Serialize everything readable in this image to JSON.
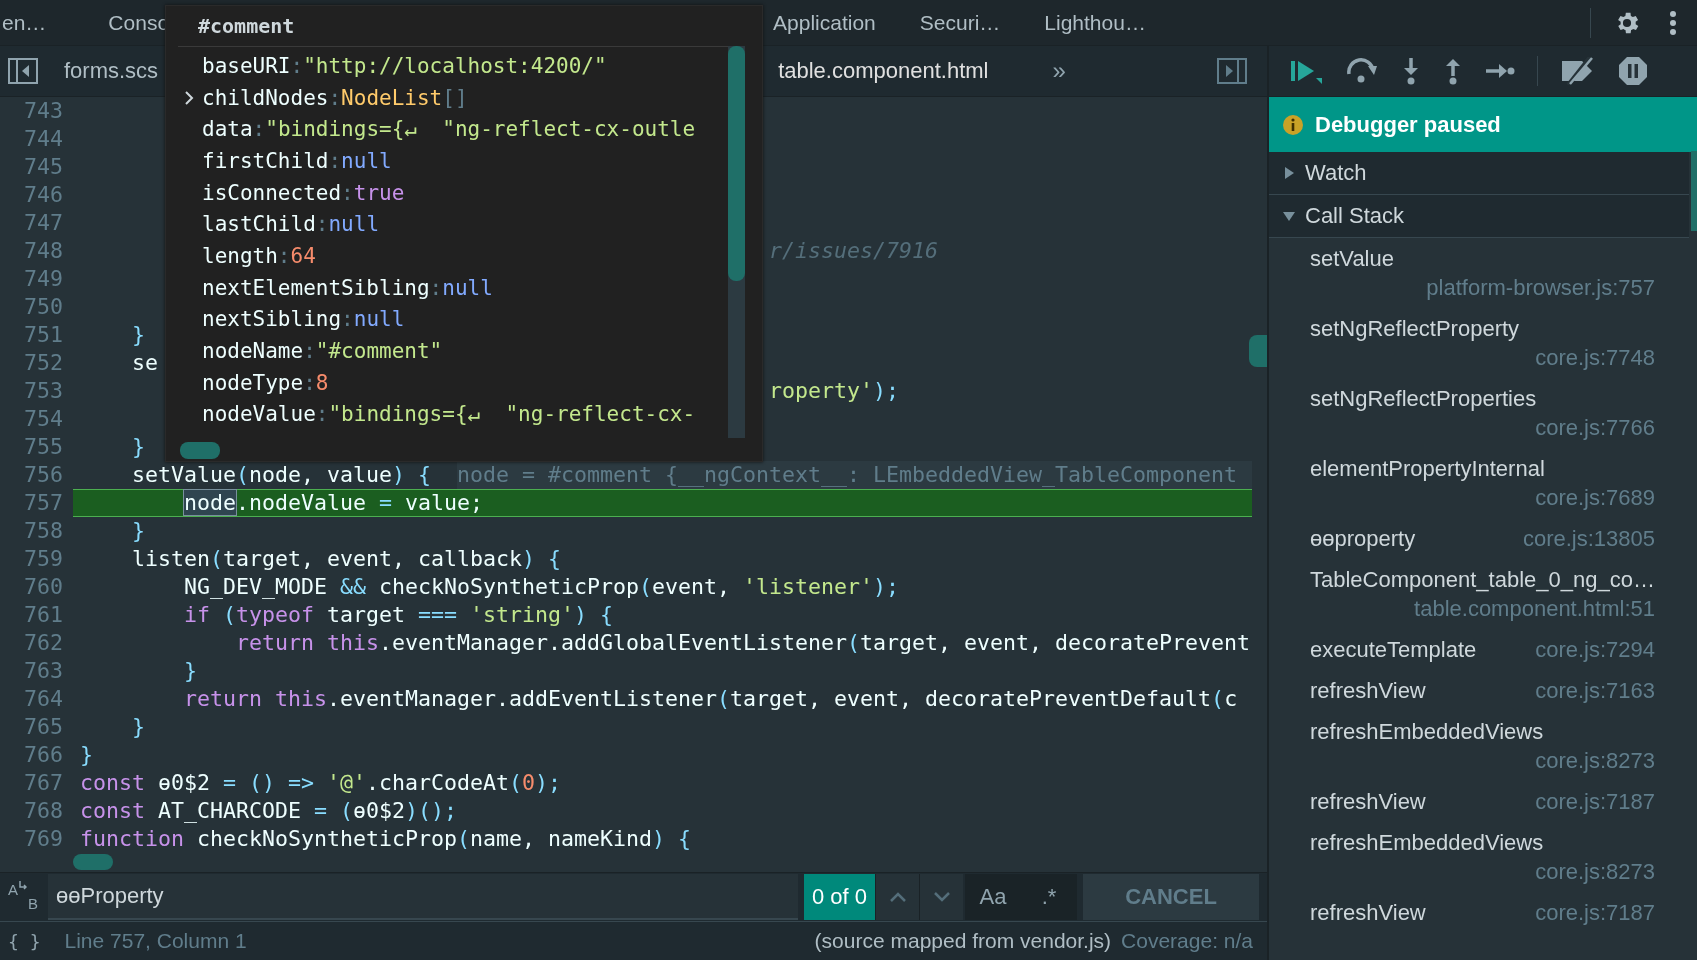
{
  "top_tabs": [
    {
      "label": "en…",
      "selected": false
    },
    {
      "label": "Conso",
      "selected": false
    },
    {
      "label": "Application",
      "selected": false
    },
    {
      "label": "Securi…",
      "selected": false
    },
    {
      "label": "Lighthou…",
      "selected": false
    }
  ],
  "editor_tabs": [
    {
      "label": "forms.scs",
      "selected": false
    },
    {
      "label": "table.component.html",
      "selected": true
    }
  ],
  "more_tabs": "»",
  "code": {
    "lines": [
      {
        "number": "743",
        "paused": false
      },
      {
        "number": "744",
        "paused": false
      },
      {
        "number": "745",
        "paused": false
      },
      {
        "number": "746",
        "paused": false
      },
      {
        "number": "747",
        "paused": false
      },
      {
        "number": "748",
        "paused": false,
        "tokens": [
          {
            "text": "                                                     r/issues/7916",
            "kind": "comment"
          }
        ]
      },
      {
        "number": "749",
        "paused": false
      },
      {
        "number": "750",
        "paused": false
      },
      {
        "number": "751",
        "paused": false,
        "tokens": [
          {
            "text": "    }",
            "kind": "op"
          }
        ]
      },
      {
        "number": "752",
        "paused": false,
        "tokens": [
          {
            "text": "    se",
            "kind": "plain"
          }
        ]
      },
      {
        "number": "753",
        "paused": false,
        "tokens": [
          {
            "text": "                                                     roperty'",
            "kind": "string"
          },
          {
            "text": ");",
            "kind": "op"
          }
        ]
      },
      {
        "number": "754",
        "paused": false
      },
      {
        "number": "755",
        "paused": false,
        "tokens": [
          {
            "text": "    }",
            "kind": "op"
          }
        ]
      },
      {
        "number": "756",
        "paused": false,
        "tokens": [
          {
            "text": "    setValue",
            "kind": "plain"
          },
          {
            "text": "(",
            "kind": "op"
          },
          {
            "text": "node, value",
            "kind": "plain"
          },
          {
            "text": ") {",
            "kind": "op"
          }
        ],
        "inline_value": "node = #comment {__ngContext__: LEmbeddedView_TableComponent"
      },
      {
        "number": "757",
        "paused": true,
        "tokens": [
          {
            "text": "        node",
            "kind": "hover"
          },
          {
            "text": ".nodeValue ",
            "kind": "plain"
          },
          {
            "text": "=",
            "kind": "op"
          },
          {
            "text": " value;",
            "kind": "plain"
          }
        ]
      },
      {
        "number": "758",
        "paused": false,
        "tokens": [
          {
            "text": "    }",
            "kind": "op"
          }
        ]
      },
      {
        "number": "759",
        "paused": false,
        "tokens": [
          {
            "text": "    listen",
            "kind": "plain"
          },
          {
            "text": "(",
            "kind": "op"
          },
          {
            "text": "target, event, callback",
            "kind": "plain"
          },
          {
            "text": ") {",
            "kind": "op"
          }
        ]
      },
      {
        "number": "760",
        "paused": false,
        "tokens": [
          {
            "text": "        NG_DEV_MODE ",
            "kind": "plain"
          },
          {
            "text": "&&",
            "kind": "op"
          },
          {
            "text": " checkNoSyntheticProp",
            "kind": "plain"
          },
          {
            "text": "(",
            "kind": "op"
          },
          {
            "text": "event, ",
            "kind": "plain"
          },
          {
            "text": "'listener'",
            "kind": "string"
          },
          {
            "text": ");",
            "kind": "op"
          }
        ]
      },
      {
        "number": "761",
        "paused": false,
        "tokens": [
          {
            "text": "        if",
            "kind": "keyword"
          },
          {
            "text": " (",
            "kind": "op"
          },
          {
            "text": "typeof",
            "kind": "keyword"
          },
          {
            "text": " target ",
            "kind": "plain"
          },
          {
            "text": "===",
            "kind": "op"
          },
          {
            "text": " 'string'",
            "kind": "string"
          },
          {
            "text": ") {",
            "kind": "op"
          }
        ]
      },
      {
        "number": "762",
        "paused": false,
        "tokens": [
          {
            "text": "            return this",
            "kind": "keyword"
          },
          {
            "text": ".eventManager.addGlobalEventListener",
            "kind": "plain"
          },
          {
            "text": "(",
            "kind": "op"
          },
          {
            "text": "target, event, decoratePrevent",
            "kind": "plain"
          }
        ]
      },
      {
        "number": "763",
        "paused": false,
        "tokens": [
          {
            "text": "        }",
            "kind": "op"
          }
        ]
      },
      {
        "number": "764",
        "paused": false,
        "tokens": [
          {
            "text": "        return this",
            "kind": "keyword"
          },
          {
            "text": ".eventManager.addEventListener",
            "kind": "plain"
          },
          {
            "text": "(",
            "kind": "op"
          },
          {
            "text": "target, event, decoratePreventDefault",
            "kind": "plain"
          },
          {
            "text": "(",
            "kind": "op"
          },
          {
            "text": "c",
            "kind": "plain"
          }
        ]
      },
      {
        "number": "765",
        "paused": false,
        "tokens": [
          {
            "text": "    }",
            "kind": "op"
          }
        ]
      },
      {
        "number": "766",
        "paused": false,
        "tokens": [
          {
            "text": "}",
            "kind": "op"
          }
        ]
      },
      {
        "number": "767",
        "paused": false,
        "tokens": [
          {
            "text": "const",
            "kind": "keyword"
          },
          {
            "text": " ɵ0$2 ",
            "kind": "plain"
          },
          {
            "text": "= () =>",
            "kind": "op"
          },
          {
            "text": " '@'",
            "kind": "string"
          },
          {
            "text": ".charCodeAt",
            "kind": "plain"
          },
          {
            "text": "(",
            "kind": "op"
          },
          {
            "text": "0",
            "kind": "number"
          },
          {
            "text": ");",
            "kind": "op"
          }
        ]
      },
      {
        "number": "768",
        "paused": false,
        "tokens": [
          {
            "text": "const",
            "kind": "keyword"
          },
          {
            "text": " AT_CHARCODE ",
            "kind": "plain"
          },
          {
            "text": "= (",
            "kind": "op"
          },
          {
            "text": "ɵ0$2",
            "kind": "plain"
          },
          {
            "text": ")();",
            "kind": "op"
          }
        ]
      },
      {
        "number": "769",
        "paused": false,
        "tokens": [
          {
            "text": "function",
            "kind": "keyword"
          },
          {
            "text": " checkNoSyntheticProp",
            "kind": "plain"
          },
          {
            "text": "(",
            "kind": "op"
          },
          {
            "text": "name, nameKind",
            "kind": "plain"
          },
          {
            "text": ") {",
            "kind": "op"
          }
        ]
      }
    ]
  },
  "popup": {
    "title": "#comment",
    "properties": [
      {
        "key": "baseURI",
        "sep": ":",
        "value": "\"http://localhost:4200/\"",
        "kind": "string",
        "expandable": false
      },
      {
        "key": "childNodes",
        "sep": ":",
        "value": "NodeList",
        "preview": "[]",
        "kind": "object",
        "expandable": true
      },
      {
        "key": "data",
        "sep": ":",
        "value": "\"bindings={↵  \"ng-reflect-cx-outle",
        "kind": "string",
        "expandable": false
      },
      {
        "key": "firstChild",
        "sep": ":",
        "value": "null",
        "kind": "null",
        "expandable": false
      },
      {
        "key": "isConnected",
        "sep": ":",
        "value": "true",
        "kind": "boolean",
        "expandable": false
      },
      {
        "key": "lastChild",
        "sep": ":",
        "value": "null",
        "kind": "null",
        "expandable": false
      },
      {
        "key": "length",
        "sep": ":",
        "value": "64",
        "kind": "number",
        "expandable": false
      },
      {
        "key": "nextElementSibling",
        "sep": ":",
        "value": "null",
        "kind": "null",
        "expandable": false
      },
      {
        "key": "nextSibling",
        "sep": ":",
        "value": "null",
        "kind": "null",
        "expandable": false
      },
      {
        "key": "nodeName",
        "sep": ":",
        "value": "\"#comment\"",
        "kind": "string",
        "expandable": false
      },
      {
        "key": "nodeType",
        "sep": ":",
        "value": "8",
        "kind": "number",
        "expandable": false
      },
      {
        "key": "nodeValue",
        "sep": ":",
        "value": "\"bindings={↵  \"ng-reflect-cx-",
        "kind": "string",
        "expandable": false
      }
    ]
  },
  "search": {
    "replace_letters": [
      "A",
      "B"
    ],
    "query": "ɵɵProperty",
    "count": "0 of 0",
    "case_label": "Aa",
    "regex_label": ".*",
    "cancel": "CANCEL"
  },
  "status_bar": {
    "brace": "{ }",
    "position": "Line 757, Column 1",
    "source": "(source mapped from vendor.js)",
    "coverage": "Coverage: n/a"
  },
  "debugger": {
    "banner": "Debugger paused",
    "sections": [
      {
        "label": "Watch",
        "expanded": false
      },
      {
        "label": "Call Stack",
        "expanded": true
      }
    ],
    "call_stack": [
      {
        "name": "setValue",
        "location": "platform-browser.js:757"
      },
      {
        "name": "setNgReflectProperty",
        "location": "core.js:7748"
      },
      {
        "name": "setNgReflectProperties",
        "location": "core.js:7766"
      },
      {
        "name": "elementPropertyInternal",
        "location": "core.js:7689"
      },
      {
        "name": "ɵɵproperty",
        "location": "core.js:13805"
      },
      {
        "name": "TableComponent_table_0_ng_co…",
        "location": "table.component.html:51"
      },
      {
        "name": "executeTemplate",
        "location": "core.js:7294"
      },
      {
        "name": "refreshView",
        "location": "core.js:7163"
      },
      {
        "name": "refreshEmbeddedViews",
        "location": "core.js:8273"
      },
      {
        "name": "refreshView",
        "location": "core.js:7187"
      },
      {
        "name": "refreshEmbeddedViews",
        "location": "core.js:8273"
      },
      {
        "name": "refreshView",
        "location": "core.js:7187"
      }
    ]
  }
}
